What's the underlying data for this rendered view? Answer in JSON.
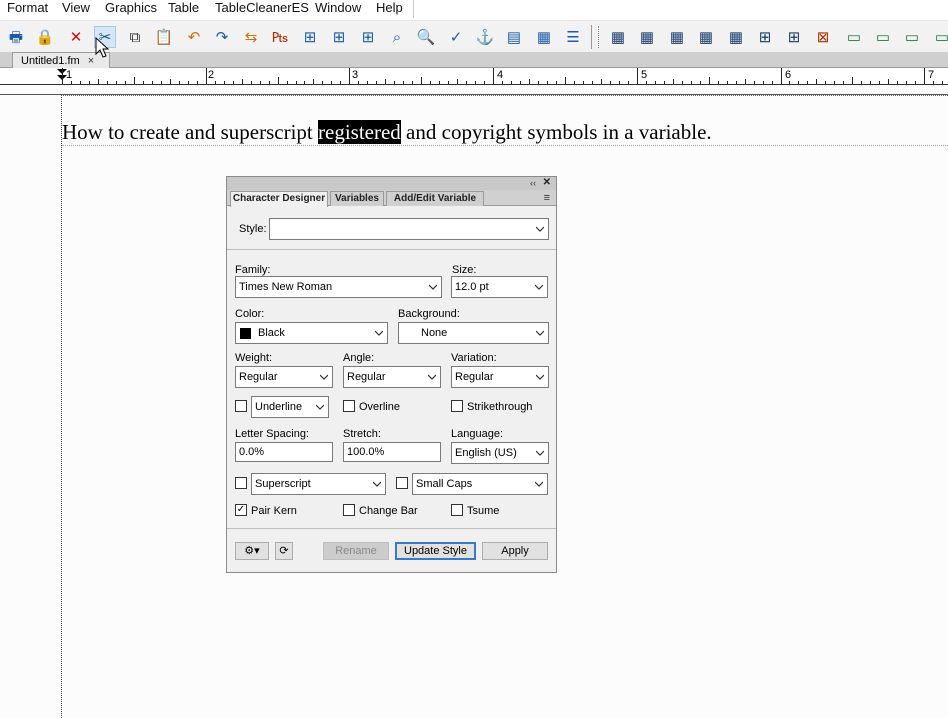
{
  "menubar": {
    "items": [
      "Format",
      "View",
      "Graphics",
      "Table",
      "TableCleanerES",
      "Window",
      "Help"
    ]
  },
  "toolbar": {
    "buttons": [
      {
        "icon": "print-icon",
        "glyph": "🖶",
        "color": "#1a5ca8"
      },
      {
        "icon": "lock-icon",
        "glyph": "🔒",
        "color": "#8a2d00"
      },
      {
        "icon": "delete-icon",
        "glyph": "✕",
        "color": "#d01010"
      },
      {
        "icon": "cut-icon",
        "glyph": "✂",
        "color": "#1a4a8a"
      },
      {
        "icon": "copy-icon",
        "glyph": "⧉",
        "color": "#333333"
      },
      {
        "icon": "paste-icon",
        "glyph": "📋",
        "color": "#c98000"
      },
      {
        "icon": "undo-icon",
        "glyph": "↶",
        "color": "#d07000"
      },
      {
        "icon": "redo-icon",
        "glyph": "↷",
        "color": "#1a5ca8"
      },
      {
        "icon": "repeat-icon",
        "glyph": "⇆",
        "color": "#d07000"
      },
      {
        "icon": "hyphenate-icon",
        "glyph": "₧",
        "color": "#b03000"
      },
      {
        "icon": "insert-text-icon",
        "glyph": "⊞",
        "color": "#1a5ca8"
      },
      {
        "icon": "insert-footnote-icon",
        "glyph": "⊞",
        "color": "#1a5ca8"
      },
      {
        "icon": "insert-table-icon",
        "glyph": "⊞",
        "color": "#1a5ca8"
      },
      {
        "icon": "find-icon",
        "glyph": "⌕",
        "color": "#1a5ca8"
      },
      {
        "icon": "zoom-icon",
        "glyph": "🔍",
        "color": "#1a5ca8"
      },
      {
        "icon": "spellcheck-icon",
        "glyph": "✓",
        "color": "#1a5ca8"
      },
      {
        "icon": "anchor-icon",
        "glyph": "⚓",
        "color": "#c98000"
      },
      {
        "icon": "text-frame-icon",
        "glyph": "▤",
        "color": "#1a5ca8"
      },
      {
        "icon": "grid-icon",
        "glyph": "▦",
        "color": "#1a5ca8"
      },
      {
        "icon": "align-icon",
        "glyph": "☰",
        "color": "#1a5ca8"
      },
      {
        "icon": "table-1-icon",
        "glyph": "▦",
        "color": "#163c6a"
      },
      {
        "icon": "table-2-icon",
        "glyph": "▦",
        "color": "#163c6a"
      },
      {
        "icon": "table-3-icon",
        "glyph": "▦",
        "color": "#163c6a"
      },
      {
        "icon": "table-4-icon",
        "glyph": "▦",
        "color": "#163c6a"
      },
      {
        "icon": "table-5-icon",
        "glyph": "▦",
        "color": "#163c6a"
      },
      {
        "icon": "table-6-icon",
        "glyph": "⊞",
        "color": "#163c6a"
      },
      {
        "icon": "table-7-icon",
        "glyph": "⊞",
        "color": "#163c6a"
      },
      {
        "icon": "table-8-icon",
        "glyph": "⊠",
        "color": "#b03000"
      },
      {
        "icon": "table-9-icon",
        "glyph": "▭",
        "color": "#1a7a3a"
      },
      {
        "icon": "table-10-icon",
        "glyph": "▭",
        "color": "#1a7a3a"
      },
      {
        "icon": "table-11-icon",
        "glyph": "▭",
        "color": "#1a7a3a"
      },
      {
        "icon": "table-12-icon",
        "glyph": "▭",
        "color": "#1a7a3a"
      }
    ]
  },
  "document": {
    "tab_title": "Untitled1.fm",
    "tab_close": "×",
    "text_before": "How to create and superscript ",
    "text_selected": "registered",
    "text_after": " and copyright symbols in a variable."
  },
  "ruler": {
    "labels": [
      "1",
      "2",
      "3",
      "4",
      "5",
      "6",
      "7"
    ]
  },
  "palette": {
    "collapse_glyph": "‹‹",
    "close_glyph": "✕",
    "menu_glyph": "≡",
    "tabs": [
      "Character Designer",
      "Variables",
      "Add/Edit Variable"
    ],
    "style_label": "Style:",
    "style_value": "",
    "family_label": "Family:",
    "family_value": "Times New Roman",
    "size_label": "Size:",
    "size_value": "12.0 pt",
    "color_label": "Color:",
    "color_value": "Black",
    "color_swatch": "#000000",
    "background_label": "Background:",
    "background_value": "None",
    "weight_label": "Weight:",
    "weight_value": "Regular",
    "angle_label": "Angle:",
    "angle_value": "Regular",
    "variation_label": "Variation:",
    "variation_value": "Regular",
    "underline_value": "Underline",
    "overline_label": "Overline",
    "strikethrough_label": "Strikethrough",
    "letter_spacing_label": "Letter Spacing:",
    "letter_spacing_value": "0.0%",
    "stretch_label": "Stretch:",
    "stretch_value": "100.0%",
    "language_label": "Language:",
    "language_value": "English (US)",
    "superscript_value": "Superscript",
    "smallcaps_value": "Small Caps",
    "pair_kern_label": "Pair Kern",
    "pair_kern_checked": "✓",
    "change_bar_label": "Change Bar",
    "tsume_label": "Tsume",
    "rename_label": "Rename",
    "update_style_label": "Update Style",
    "apply_label": "Apply",
    "gear_glyph": "⚙▾",
    "refresh_glyph": "⟳"
  }
}
